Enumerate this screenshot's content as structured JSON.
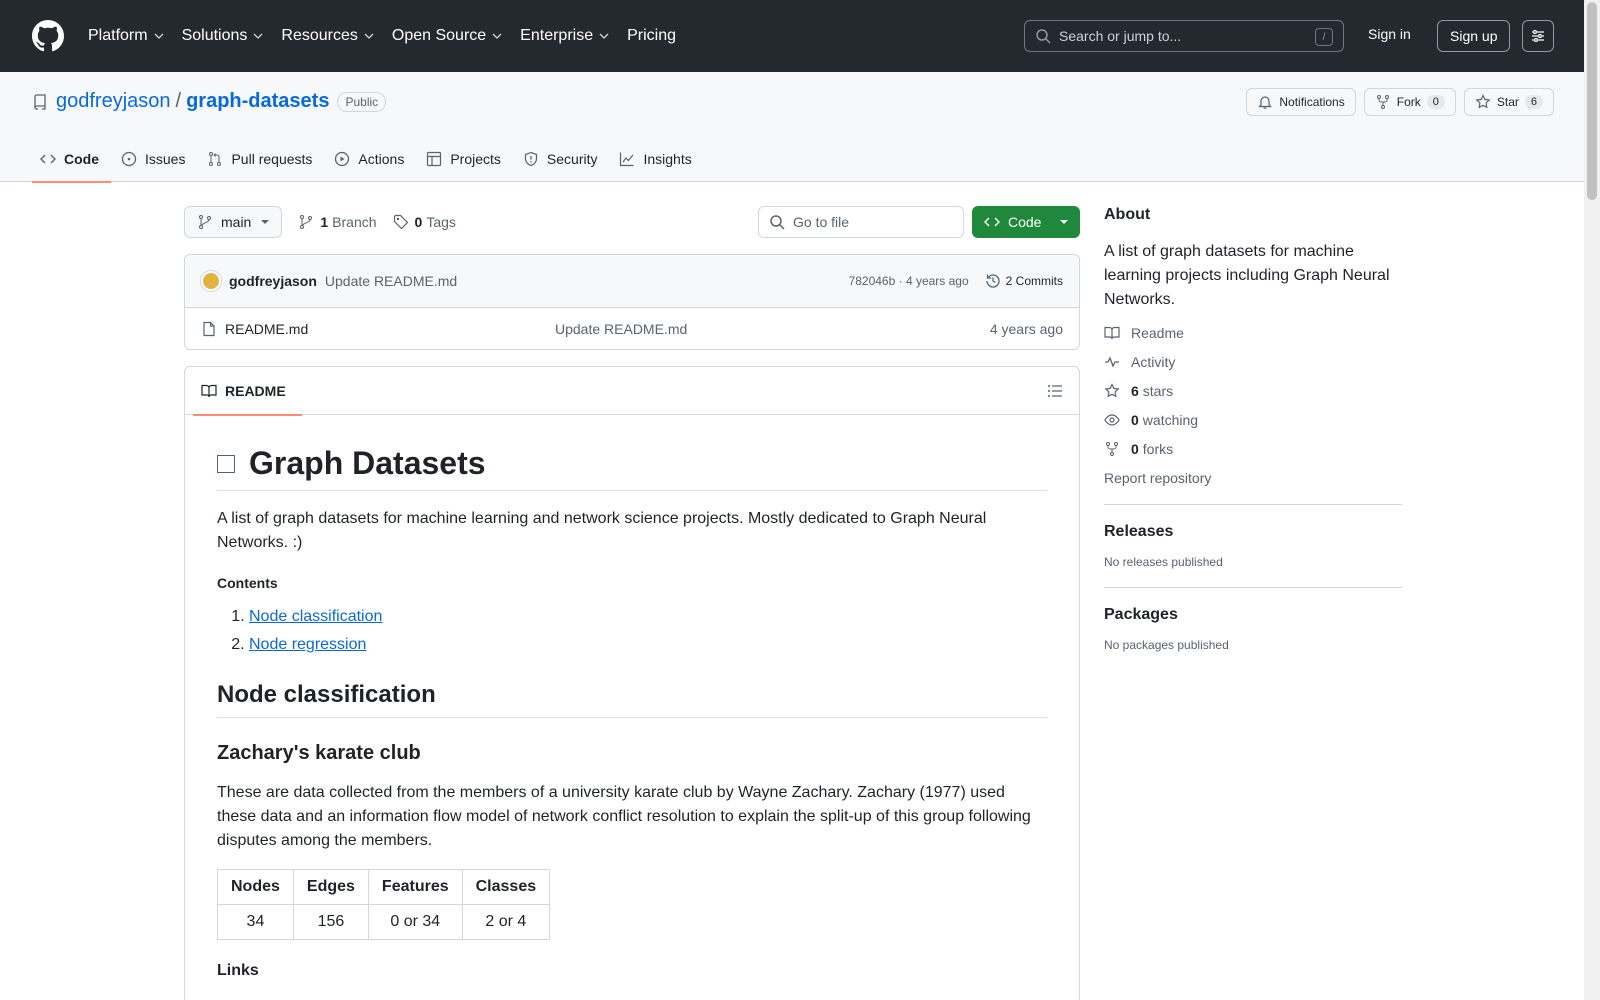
{
  "header": {
    "nav": [
      "Platform",
      "Solutions",
      "Resources",
      "Open Source",
      "Enterprise",
      "Pricing"
    ],
    "search_placeholder": "Search or jump to...",
    "search_key": "/",
    "signin": "Sign in",
    "signup": "Sign up"
  },
  "repo": {
    "owner": "godfreyjason",
    "separator": "/",
    "name": "graph-datasets",
    "visibility": "Public",
    "notifications": "Notifications",
    "fork": "Fork",
    "fork_count": "0",
    "star": "Star",
    "star_count": "6",
    "tabs": [
      "Code",
      "Issues",
      "Pull requests",
      "Actions",
      "Projects",
      "Security",
      "Insights"
    ]
  },
  "files": {
    "branch": "main",
    "branch_count": "1",
    "branch_label": "Branch",
    "tag_count": "0",
    "tag_label": "Tags",
    "goto_placeholder": "Go to file",
    "code_button": "Code",
    "commit_author": "godfreyjason",
    "commit_message": "Update README.md",
    "commit_meta": "782046b · 4 years ago",
    "commit_count": "2 Commits",
    "rows": [
      {
        "name": "README.md",
        "commit": "Update README.md",
        "age": "4 years ago"
      }
    ]
  },
  "readme": {
    "tab": "README",
    "title": "Graph Datasets",
    "intro": "A list of graph datasets for machine learning and network science projects. Mostly dedicated to Graph Neural Networks. :)",
    "contents_heading": "Contents",
    "contents": [
      "Node classification",
      "Node regression"
    ],
    "section1": "Node classification",
    "subsection1": "Zachary's karate club",
    "subsection1_text": "These are data collected from the members of a university karate club by Wayne Zachary. Zachary (1977) used these data and an information flow model of network conflict resolution to explain the split-up of this group following disputes among the members.",
    "table_headers": [
      "Nodes",
      "Edges",
      "Features",
      "Classes"
    ],
    "table_row": [
      "34",
      "156",
      "0 or 34",
      "2 or 4"
    ],
    "links_heading": "Links"
  },
  "sidebar": {
    "about_heading": "About",
    "description": "A list of graph datasets for machine learning projects including Graph Neural Networks.",
    "readme": "Readme",
    "activity": "Activity",
    "stars_count": "6",
    "stars_label": "stars",
    "watching_count": "0",
    "watching_label": "watching",
    "forks_count": "0",
    "forks_label": "forks",
    "report": "Report repository",
    "releases_heading": "Releases",
    "releases_text": "No releases published",
    "packages_heading": "Packages",
    "packages_text": "No packages published"
  },
  "colors": {
    "header_bg": "#24292f",
    "link": "#0969da",
    "code_button": "#1f883d",
    "active_tab_underline": "#fd8c73"
  }
}
